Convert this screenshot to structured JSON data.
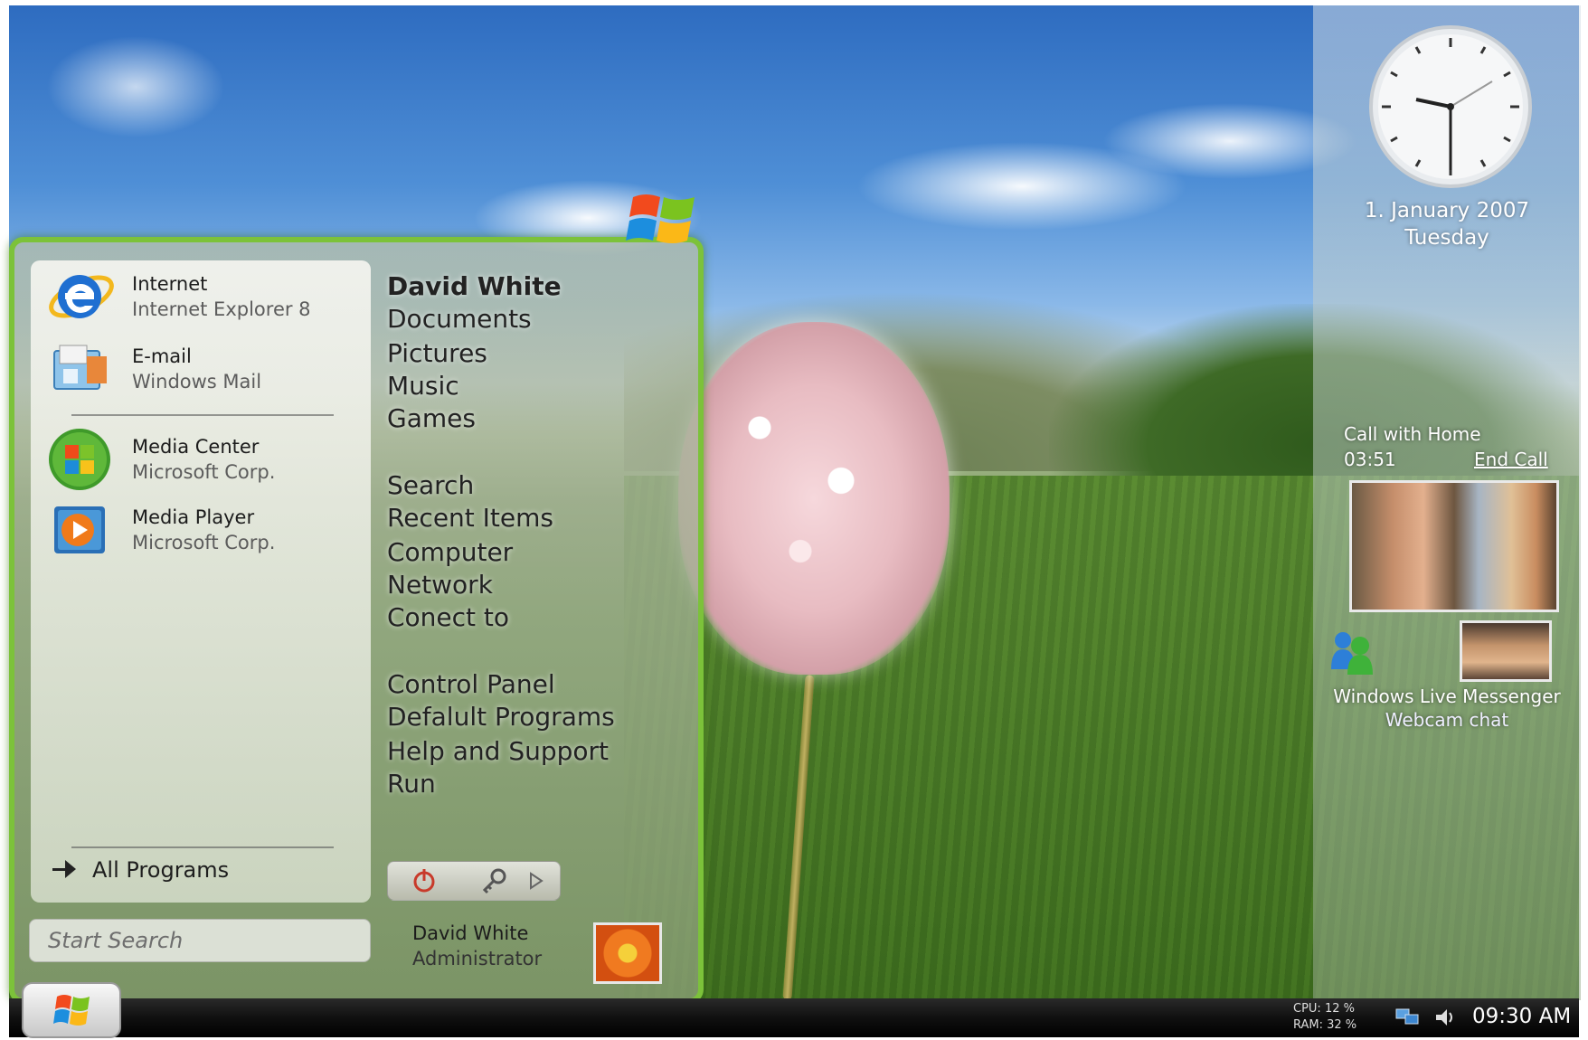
{
  "start_menu": {
    "pinned": [
      {
        "title": "Internet",
        "subtitle": "Internet Explorer 8",
        "icon": "ie-icon"
      },
      {
        "title": "E-mail",
        "subtitle": "Windows Mail",
        "icon": "mail-icon"
      }
    ],
    "recent": [
      {
        "title": "Media Center",
        "subtitle": "Microsoft Corp.",
        "icon": "media-center-icon"
      },
      {
        "title": "Media Player",
        "subtitle": "Microsoft Corp.",
        "icon": "media-player-icon"
      }
    ],
    "all_programs_label": "All Programs",
    "search_placeholder": "Start Search",
    "places": [
      "David White",
      "Documents",
      "Pictures",
      "Music",
      "Games",
      "Search",
      "Recent Items",
      "Computer",
      "Network",
      "Conect to",
      "Control Panel",
      "Defalult Programs",
      "Help and Support",
      "Run"
    ],
    "user": {
      "name": "David White",
      "role": "Administrator"
    }
  },
  "sidebar": {
    "date": "1. January 2007",
    "day": "Tuesday",
    "call_title": "Call with Home",
    "call_time": "03:51",
    "end_call_label": "End Call",
    "messenger_title": "Windows Live Messenger",
    "messenger_sub": "Webcam chat"
  },
  "taskbar": {
    "cpu": "CPU: 12 %",
    "ram": "RAM: 32 %",
    "time": "09:30 AM"
  },
  "colors": {
    "menu_border": "#7cc23a",
    "taskbar": "#101010"
  }
}
